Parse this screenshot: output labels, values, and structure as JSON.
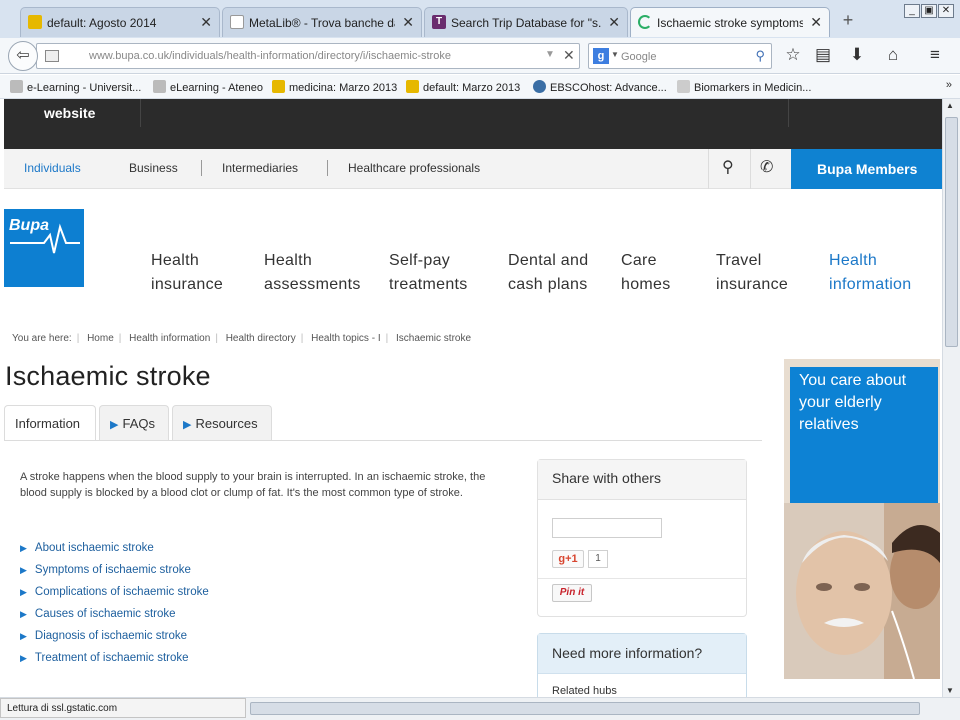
{
  "browser": {
    "tabs": [
      {
        "title": "default: Agosto 2014",
        "favicon": "notebook-icon",
        "color": "#e6b800"
      },
      {
        "title": "MetaLib® - Trova banche dati",
        "favicon": "page-icon",
        "color": "#ffffff"
      },
      {
        "title": "Search Trip Database for \"s...",
        "favicon": "trip-icon",
        "color": "#6a2c6e"
      },
      {
        "title": "Ischaemic stroke symptoms,...",
        "favicon": "loading-icon",
        "color": "#2bae66"
      }
    ],
    "url": "www.bupa.co.uk/individuals/health-information/directory/i/ischaemic-stroke",
    "search_placeholder": "Google",
    "search_engine_letter": "g",
    "bookmarks": [
      {
        "label": "e-Learning - Universit...",
        "icon_color": "#bbbbbb"
      },
      {
        "label": "eLearning - Ateneo",
        "icon_color": "#bbbbbb"
      },
      {
        "label": "medicina: Marzo 2013",
        "icon_color": "#e6b800"
      },
      {
        "label": "default: Marzo 2013",
        "icon_color": "#e6b800"
      },
      {
        "label": "EBSCOhost: Advance...",
        "icon_color": "#3a6ea5"
      },
      {
        "label": "Biomarkers in Medicin...",
        "icon_color": "#cccccc"
      }
    ],
    "status_text": "Lettura di ssl.gstatic.com"
  },
  "site": {
    "top_label": "website",
    "segments": [
      "Individuals",
      "Business",
      "Intermediaries",
      "Healthcare professionals"
    ],
    "members_label": "Bupa Members",
    "logo_text": "Bupa",
    "brand_color": "#0d7fd1",
    "main_nav": [
      {
        "line1": "Health",
        "line2": "insurance"
      },
      {
        "line1": "Health",
        "line2": "assessments"
      },
      {
        "line1": "Self-pay",
        "line2": "treatments"
      },
      {
        "line1": "Dental and",
        "line2": "cash plans"
      },
      {
        "line1": "Care",
        "line2": "homes"
      },
      {
        "line1": "Travel",
        "line2": "insurance"
      },
      {
        "line1": "Health",
        "line2": "information"
      }
    ]
  },
  "page": {
    "breadcrumb": [
      "You are here:",
      "Home",
      "Health information",
      "Health directory",
      "Health topics - I",
      "Ischaemic stroke"
    ],
    "title": "Ischaemic stroke",
    "tabs": [
      "Information",
      "FAQs",
      "Resources"
    ],
    "intro": "A stroke happens when the blood supply to your brain is interrupted. In an ischaemic stroke, the blood supply is blocked by a blood clot or clump of fat. It's the most common type of stroke.",
    "links": [
      "About ischaemic stroke",
      "Symptoms of ischaemic stroke",
      "Complications of ischaemic stroke",
      "Causes of ischaemic stroke",
      "Diagnosis of ischaemic stroke",
      "Treatment of ischaemic stroke"
    ],
    "share": {
      "heading": "Share with others",
      "gplus_label": "g+1",
      "gplus_count": "1",
      "pin_label": "Pin it"
    },
    "need_more": {
      "heading": "Need more information?",
      "related": "Related hubs"
    },
    "ad_text": "You care about your elderly relatives"
  }
}
